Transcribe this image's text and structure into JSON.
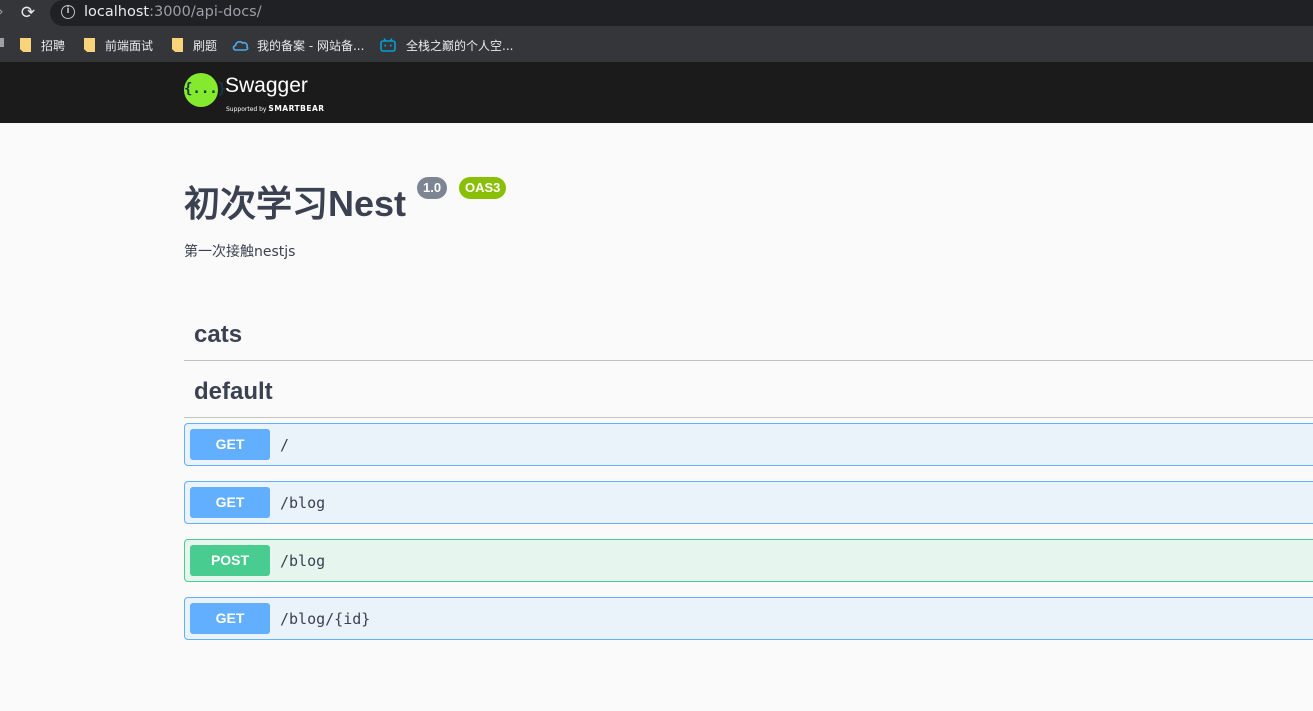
{
  "browser": {
    "url_host": "localhost",
    "url_rest": ":3000/api-docs/",
    "bookmarks": [
      {
        "label": "招聘",
        "icon": "folder-icon"
      },
      {
        "label": "前端面试",
        "icon": "folder-icon"
      },
      {
        "label": "刷题",
        "icon": "folder-icon"
      },
      {
        "label": "我的备案 - 网站备...",
        "icon": "cloud-icon"
      },
      {
        "label": "全栈之巅的个人空...",
        "icon": "bilibili-icon"
      }
    ]
  },
  "topbar": {
    "logo_symbol": "{...}",
    "title": "Swagger",
    "tagline": "Supported by",
    "brand": "SMARTBEAR"
  },
  "info": {
    "title": "初次学习Nest",
    "version": "1.0",
    "oas": "OAS3",
    "description": "第一次接触nestjs"
  },
  "tags": [
    {
      "name": "cats",
      "operations": []
    },
    {
      "name": "default",
      "operations": [
        {
          "method": "GET",
          "path": "/"
        },
        {
          "method": "GET",
          "path": "/blog"
        },
        {
          "method": "POST",
          "path": "/blog"
        },
        {
          "method": "GET",
          "path": "/blog/{id}"
        }
      ]
    }
  ],
  "colors": {
    "get": "#61affe",
    "post": "#49cc90",
    "swagger_green": "#85ea2d",
    "oas_badge": "#89bf04",
    "version_badge": "#7d8492",
    "text": "#3b4151"
  }
}
